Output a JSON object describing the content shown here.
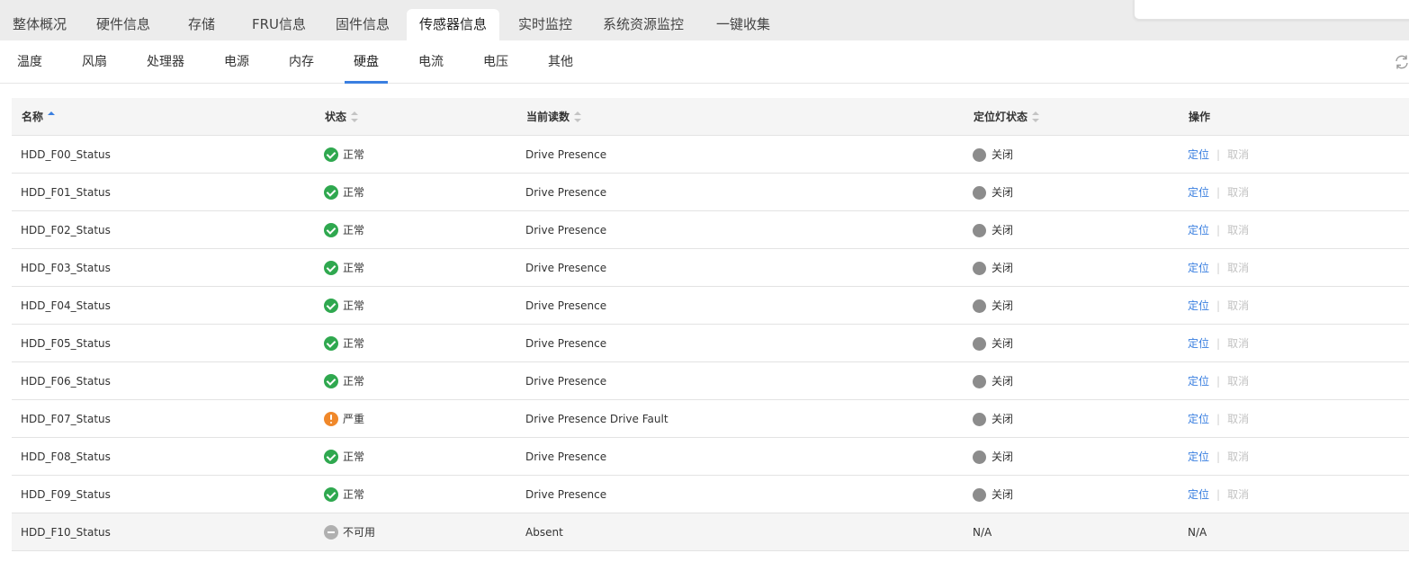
{
  "top_tabs": [
    {
      "label": "整体概况",
      "active": false
    },
    {
      "label": "硬件信息",
      "active": false
    },
    {
      "label": "存储",
      "active": false
    },
    {
      "label": "FRU信息",
      "active": false
    },
    {
      "label": "固件信息",
      "active": false
    },
    {
      "label": "传感器信息",
      "active": true
    },
    {
      "label": "实时监控",
      "active": false
    },
    {
      "label": "系统资源监控",
      "active": false
    },
    {
      "label": "一键收集",
      "active": false
    }
  ],
  "sub_tabs": [
    {
      "label": "温度",
      "active": false
    },
    {
      "label": "风扇",
      "active": false
    },
    {
      "label": "处理器",
      "active": false
    },
    {
      "label": "电源",
      "active": false
    },
    {
      "label": "内存",
      "active": false
    },
    {
      "label": "硬盘",
      "active": true
    },
    {
      "label": "电流",
      "active": false
    },
    {
      "label": "电压",
      "active": false
    },
    {
      "label": "其他",
      "active": false
    }
  ],
  "refresh_icon": "refresh-icon",
  "colors": {
    "accent": "#3a7fe0",
    "ok": "#2fa84f",
    "critical": "#f0882a",
    "unavailable": "#b0b0b0",
    "led_off": "#8c8c8c"
  },
  "table": {
    "headers": {
      "name": "名称",
      "status": "状态",
      "reading": "当前读数",
      "led": "定位灯状态",
      "actions": "操作"
    },
    "sort": {
      "column": "name",
      "direction": "asc"
    },
    "rows": [
      {
        "name": "HDD_F00_Status",
        "status": "正常",
        "status_kind": "ok",
        "reading": "Drive Presence",
        "led": "关闭",
        "has_led": true,
        "locate": "定位",
        "cancel": "取消"
      },
      {
        "name": "HDD_F01_Status",
        "status": "正常",
        "status_kind": "ok",
        "reading": "Drive Presence",
        "led": "关闭",
        "has_led": true,
        "locate": "定位",
        "cancel": "取消"
      },
      {
        "name": "HDD_F02_Status",
        "status": "正常",
        "status_kind": "ok",
        "reading": "Drive Presence",
        "led": "关闭",
        "has_led": true,
        "locate": "定位",
        "cancel": "取消"
      },
      {
        "name": "HDD_F03_Status",
        "status": "正常",
        "status_kind": "ok",
        "reading": "Drive Presence",
        "led": "关闭",
        "has_led": true,
        "locate": "定位",
        "cancel": "取消"
      },
      {
        "name": "HDD_F04_Status",
        "status": "正常",
        "status_kind": "ok",
        "reading": "Drive Presence",
        "led": "关闭",
        "has_led": true,
        "locate": "定位",
        "cancel": "取消"
      },
      {
        "name": "HDD_F05_Status",
        "status": "正常",
        "status_kind": "ok",
        "reading": "Drive Presence",
        "led": "关闭",
        "has_led": true,
        "locate": "定位",
        "cancel": "取消"
      },
      {
        "name": "HDD_F06_Status",
        "status": "正常",
        "status_kind": "ok",
        "reading": "Drive Presence",
        "led": "关闭",
        "has_led": true,
        "locate": "定位",
        "cancel": "取消"
      },
      {
        "name": "HDD_F07_Status",
        "status": "严重",
        "status_kind": "critical",
        "reading": "Drive Presence Drive Fault",
        "led": "关闭",
        "has_led": true,
        "locate": "定位",
        "cancel": "取消"
      },
      {
        "name": "HDD_F08_Status",
        "status": "正常",
        "status_kind": "ok",
        "reading": "Drive Presence",
        "led": "关闭",
        "has_led": true,
        "locate": "定位",
        "cancel": "取消"
      },
      {
        "name": "HDD_F09_Status",
        "status": "正常",
        "status_kind": "ok",
        "reading": "Drive Presence",
        "led": "关闭",
        "has_led": true,
        "locate": "定位",
        "cancel": "取消"
      },
      {
        "name": "HDD_F10_Status",
        "status": "不可用",
        "status_kind": "unavailable",
        "reading": "Absent",
        "led": "N/A",
        "has_led": false,
        "action_text": "N/A"
      }
    ]
  }
}
